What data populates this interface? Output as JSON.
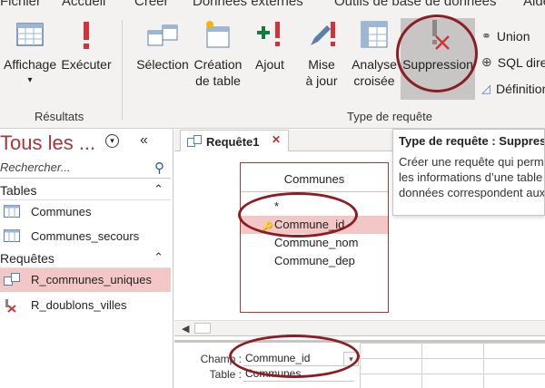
{
  "menubar": [
    "Fichier",
    "Accueil",
    "Créer",
    "Données externes",
    "Outils de base de données",
    "Aide"
  ],
  "ribbon": {
    "groups": [
      {
        "label": "Résultats",
        "buttons": [
          "Affichage",
          "Exécuter"
        ]
      },
      {
        "label": "Type de requête",
        "buttons": [
          "Sélection",
          "Création de table",
          "Ajout",
          "Mise à jour",
          "Analyse croisée",
          "Suppression"
        ]
      }
    ],
    "affichage": "Affichage",
    "affichage_dropdown": "▾",
    "executer": "Exécuter",
    "selection": "Sélection",
    "creation_l1": "Création",
    "creation_l2": "de table",
    "ajout": "Ajout",
    "maj_l1": "Mise",
    "maj_l2": "à jour",
    "analyse_l1": "Analyse",
    "analyse_l2": "croisée",
    "suppression": "Suppression",
    "results_group": "Résultats",
    "type_group": "Type de requête",
    "small": {
      "union": "Union",
      "sql": "SQL direct",
      "definition": "Définition"
    }
  },
  "tooltip": {
    "title": "Type de requête : Suppression",
    "lines": [
      "Créer une requête qui permet de supprimer",
      "les informations d’une table dont les",
      "données correspondent aux critères."
    ]
  },
  "nav": {
    "title": "Tous les ...",
    "search_placeholder": "Rechercher...",
    "sections": [
      {
        "label": "Tables",
        "items": [
          "Communes",
          "Communes_secours"
        ]
      },
      {
        "label": "Requêtes",
        "items": [
          "R_communes_uniques",
          "R_doublons_villes"
        ]
      }
    ],
    "tables_label": "Tables",
    "requetes_label": "Requêtes",
    "table1": "Communes",
    "table2": "Communes_secours",
    "query1": "R_communes_uniques",
    "query2": "R_doublons_villes"
  },
  "doc": {
    "tab_label": "Requête1",
    "table": {
      "name": "Communes",
      "fields": [
        "*",
        "Commune_id",
        "Commune_nom",
        "Commune_dep"
      ],
      "selected_field": "Commune_id"
    },
    "grid": {
      "champ_label": "Champ :",
      "champ_value": "Commune_id",
      "table_label": "Table :",
      "table_value": "Communes"
    }
  },
  "colors": {
    "accent": "#a4373a",
    "selection": "#f4c7c7",
    "highlight_circle": "#8b1e22"
  }
}
